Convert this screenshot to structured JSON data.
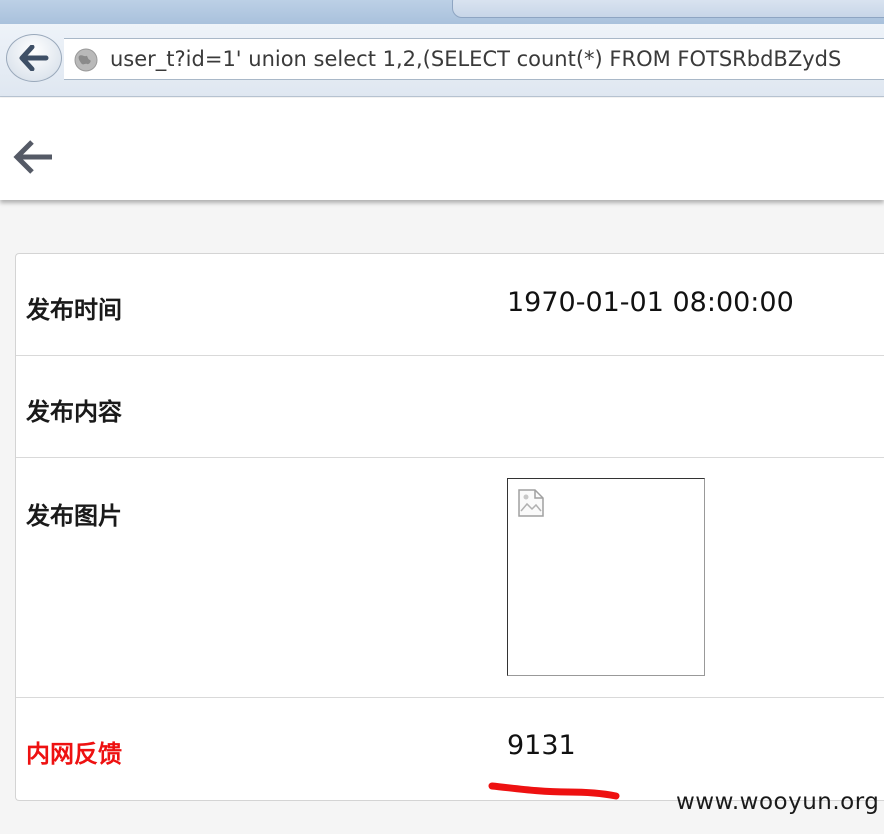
{
  "browser": {
    "url": "user_t?id=1' union select 1,2,(SELECT count(*) FROM FOTSRbdBZydS"
  },
  "detail": {
    "rows": [
      {
        "label": "发布时间",
        "value": "1970-01-01 08:00:00"
      },
      {
        "label": "发布内容",
        "value": ""
      },
      {
        "label": "发布图片",
        "value": ""
      },
      {
        "label": "内网反馈",
        "value": "9131"
      }
    ]
  },
  "colors": {
    "highlight_label": "#ee1111",
    "annotation_stroke": "#ee1111"
  },
  "icons": {
    "browser_back": "arrow-left-icon",
    "site_identity": "globe-icon",
    "page_back": "arrow-left-icon",
    "image_placeholder": "broken-image-icon"
  },
  "watermark": "www.wooyun.org"
}
